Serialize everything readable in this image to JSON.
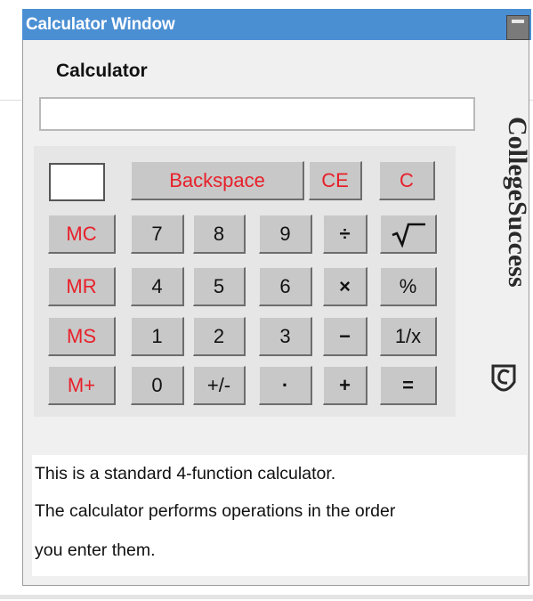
{
  "window": {
    "title": "Calculator Window"
  },
  "calculator": {
    "heading": "Calculator",
    "display_value": "",
    "brand": "CollegeSuccess",
    "keys": {
      "backspace": "Backspace",
      "ce": "CE",
      "c": "C",
      "mc": "MC",
      "mr": "MR",
      "ms": "MS",
      "mplus": "M+",
      "d7": "7",
      "d8": "8",
      "d9": "9",
      "d4": "4",
      "d5": "5",
      "d6": "6",
      "d1": "1",
      "d2": "2",
      "d3": "3",
      "d0": "0",
      "sign": "+/-",
      "dot": "·",
      "divide": "÷",
      "multiply": "×",
      "subtract": "−",
      "add": "+",
      "percent": "%",
      "reciprocal": "1/x",
      "equals": "="
    }
  },
  "info": {
    "lines": [
      "This is a standard 4-function calculator.",
      "The calculator performs operations in the order",
      "you enter them."
    ]
  },
  "colors": {
    "titlebar": "#4b8fd3",
    "red_key_text": "#e8202a",
    "key_face": "#c8c8c8"
  }
}
